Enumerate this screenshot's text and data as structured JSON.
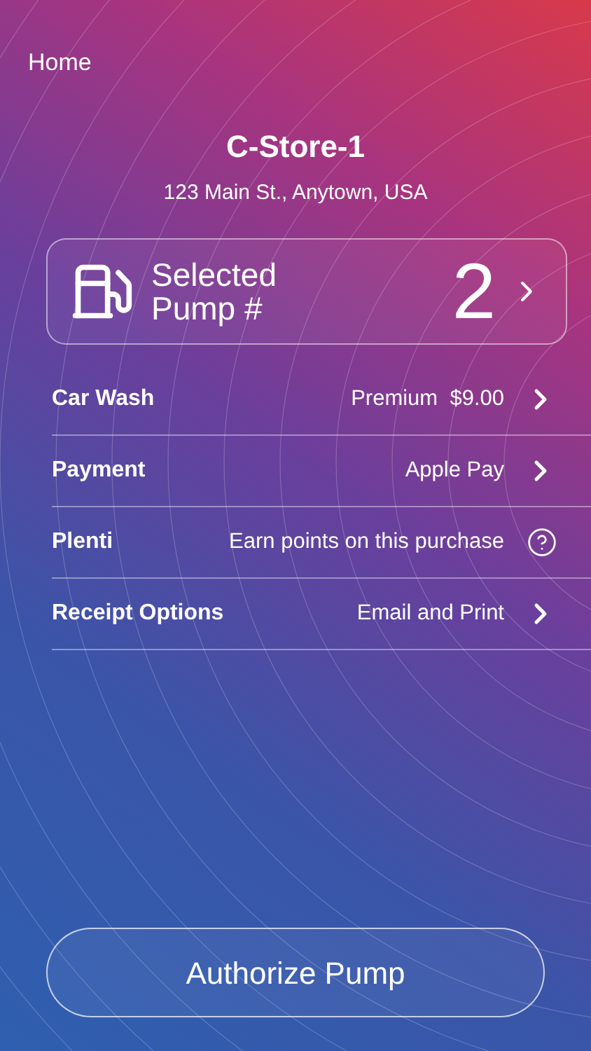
{
  "nav": {
    "back": "Home"
  },
  "store": {
    "name": "C-Store-1",
    "address": "123 Main St., Anytown, USA"
  },
  "pump": {
    "label": "Selected Pump #",
    "number": "2"
  },
  "options": [
    {
      "kind": "link",
      "label": "Car Wash",
      "value": "Premium  $9.00"
    },
    {
      "kind": "link",
      "label": "Payment",
      "value": "Apple Pay"
    },
    {
      "kind": "info",
      "label": "Plenti",
      "value": "Earn points on this purchase"
    },
    {
      "kind": "link",
      "label": "Receipt Options",
      "value": "Email and Print"
    }
  ],
  "action": {
    "label": "Authorize Pump"
  }
}
